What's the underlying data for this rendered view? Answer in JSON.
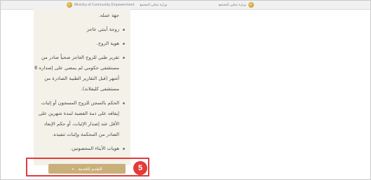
{
  "header": {
    "left_logo_en": "Ministry of Community Empowerment",
    "left_logo_ar": "وزارة تمكين المجتمع",
    "right_logo_ar": "وزارة تمكين المجتمع",
    "emblem_icon": "uae-emblem-icon"
  },
  "requirements": {
    "items": [
      {
        "text": "جهة عمله.",
        "bullet": false
      },
      {
        "text": "زوجة أبنتي عاجز",
        "bullet": true
      },
      {
        "text": "هوية الزوج.",
        "bullet": true
      },
      {
        "text": "تقرير طبي للزوج العاجز صحياً صادر من مستشفى حكومي لم يمضي على إصداره 6 أشهر (قبل التقارير الطبية الصادرة من مستشفى كليفلاند).",
        "bullet": true
      },
      {
        "text": "الحكم بالسجن للزوج المسجون أو إثبات إيقافه على ذمة القضية لمدة شهرين على الأقل عند إصدار الإثبات، أو حكم الإبعاد الصادر من المحكمة وإثبات تنفيذه.",
        "bullet": true
      },
      {
        "text": "هويات الأبناء المحضونين.",
        "bullet": true
      }
    ]
  },
  "action": {
    "apply_label": "التقدم للخدمة",
    "arrow_icon": "arrow-left-icon"
  },
  "step_badge": "5",
  "colors": {
    "button": "#c9b07a",
    "highlight": "#e23b3b",
    "panel": "#f4f1e9"
  }
}
